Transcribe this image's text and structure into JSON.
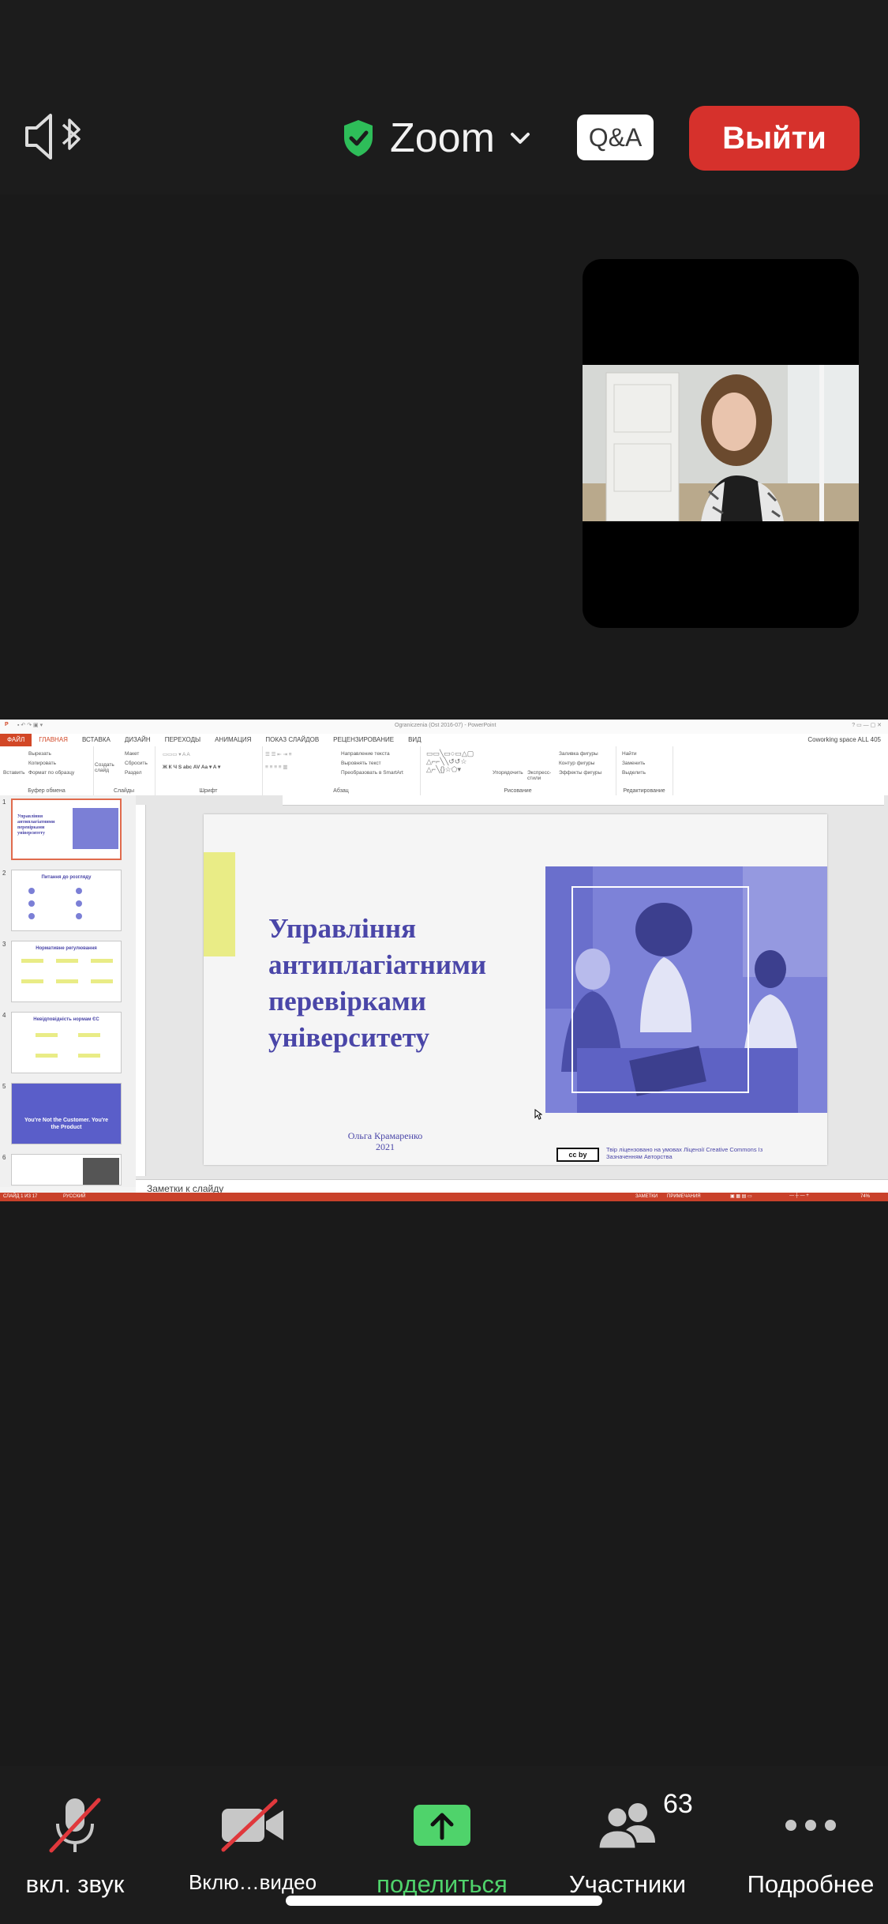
{
  "header": {
    "app_title": "Zoom",
    "qa_label": "Q&A",
    "leave_label": "Выйти",
    "security_color": "#2ebd59",
    "leave_color": "#d6312c"
  },
  "powerpoint": {
    "title_bar": "Ograniczenia (Ost 2016-07) - PowerPoint",
    "account": "Coworking space ALL 405",
    "tabs": [
      "ФАЙЛ",
      "ГЛАВНАЯ",
      "ВСТАВКА",
      "ДИЗАЙН",
      "ПЕРЕХОДЫ",
      "АНИМАЦИЯ",
      "ПОКАЗ СЛАЙДОВ",
      "РЕЦЕНЗИРОВАНИЕ",
      "ВИД"
    ],
    "ribbon_groups": {
      "clipboard": "Буфер обмена",
      "slides": "Слайды",
      "font": "Шрифт",
      "paragraph": "Абзац",
      "drawing": "Рисование",
      "editing": "Редактирование"
    },
    "ribbon_small": {
      "cut": "Вырезать",
      "copy": "Копировать",
      "format_painter": "Формат по образцу",
      "paste": "Вставить",
      "new_slide": "Создать слайд",
      "layout": "Макет",
      "reset": "Сбросить",
      "section": "Раздел",
      "text_direction": "Направление текста",
      "align_text": "Выровнять текст",
      "smartart": "Преобразовать в SmartArt",
      "arrange": "Упорядочить",
      "quick_styles": "Экспресс-стили",
      "shape_fill": "Заливка фигуры",
      "shape_outline": "Контур фигуры",
      "shape_effects": "Эффекты фигуры",
      "find": "Найти",
      "replace": "Заменить",
      "select": "Выделить"
    },
    "thumbnails": [
      {
        "num": "1",
        "text": "Управління антиплагіатними перевірками університету"
      },
      {
        "num": "2",
        "text": "Питання до розгляду"
      },
      {
        "num": "3",
        "text": "Нормативне регулювання"
      },
      {
        "num": "4",
        "text": "Невідповідність нормам ЄС"
      },
      {
        "num": "5",
        "text": "You're Not the Customer. You're the Product"
      },
      {
        "num": "6",
        "text": ""
      }
    ],
    "slide": {
      "title": "Управління антиплагіатними перевірками університету",
      "author": "Ольга Крамаренко",
      "year": "2021",
      "cc_badge": "cc by",
      "license": "Твір ліцензовано на умовах Ліцензії Creative Commons Із Зазначенням Авторства",
      "accent_color": "#4a46a8",
      "bar_color": "#e9ec86"
    },
    "notes_placeholder": "Заметки к слайду",
    "status": {
      "slide_info": "СЛАЙД 1 ИЗ 17",
      "language": "РУССКИЙ",
      "notes": "ЗАМЕТКИ",
      "comments": "ПРИМЕЧАНИЯ",
      "zoom": "74%"
    }
  },
  "toolbar": {
    "mute_label": "вкл. звук",
    "video_label": "Вклю…видео",
    "share_label": "поделиться",
    "participants_label": "Участники",
    "participants_count": "63",
    "more_label": "Подробнее"
  }
}
